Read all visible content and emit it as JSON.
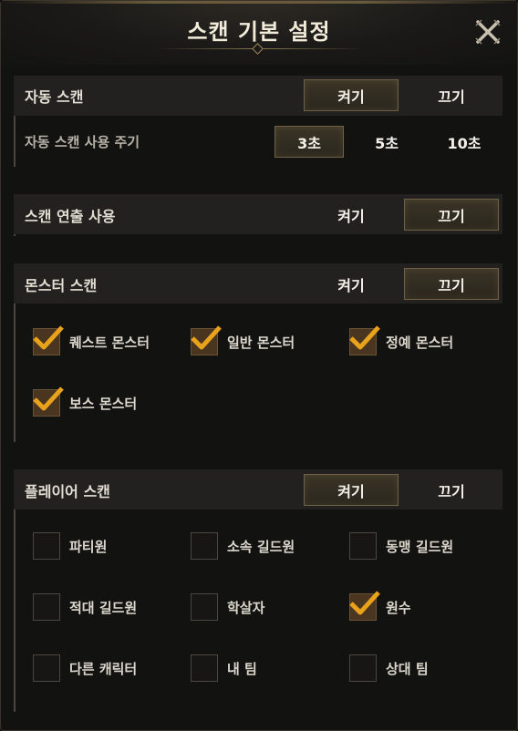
{
  "title": "스캔 기본 설정",
  "auto_scan": {
    "label": "자동 스캔",
    "on": "켜기",
    "off": "끄기",
    "state": "on",
    "interval_label": "자동 스캔 사용 주기",
    "intervals": [
      "3초",
      "5초",
      "10초"
    ],
    "selected_interval": "3초"
  },
  "scan_effect": {
    "label": "스캔 연출 사용",
    "on": "켜기",
    "off": "끄기",
    "state": "off"
  },
  "monster_scan": {
    "label": "몬스터 스캔",
    "on": "켜기",
    "off": "끄기",
    "state": "off",
    "options": [
      {
        "label": "퀘스트 몬스터",
        "checked": true
      },
      {
        "label": "일반 몬스터",
        "checked": true
      },
      {
        "label": "정예 몬스터",
        "checked": true
      },
      {
        "label": "보스 몬스터",
        "checked": true
      }
    ]
  },
  "player_scan": {
    "label": "플레이어 스캔",
    "on": "켜기",
    "off": "끄기",
    "state": "on",
    "options": [
      {
        "label": "파티원",
        "checked": false
      },
      {
        "label": "소속 길드원",
        "checked": false
      },
      {
        "label": "동맹 길드원",
        "checked": false
      },
      {
        "label": "적대 길드원",
        "checked": false
      },
      {
        "label": "학살자",
        "checked": false
      },
      {
        "label": "원수",
        "checked": true
      },
      {
        "label": "다른 캐릭터",
        "checked": false
      },
      {
        "label": "내 팀",
        "checked": false
      },
      {
        "label": "상대 팀",
        "checked": false
      }
    ]
  },
  "colors": {
    "accent_gold": "#e8a21c",
    "checked_box": "#4a3520",
    "active_toggle_border": "#6e6146"
  },
  "icons": {
    "close": "close-x-icon",
    "check": "checkmark-icon"
  }
}
